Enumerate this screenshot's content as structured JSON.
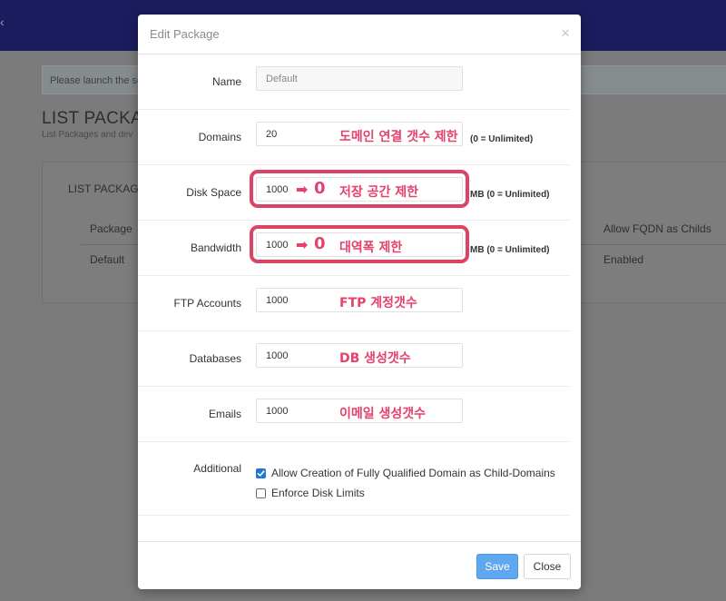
{
  "background": {
    "notice": "Please launch the se",
    "page_title": "LIST PACKAC",
    "page_subtitle": "List Packages and dev",
    "card_title": "LIST PACKAGE",
    "table": {
      "headers": [
        "Package",
        "Allow FQDN as Childs"
      ],
      "row": [
        "Default",
        "Enabled"
      ]
    }
  },
  "modal": {
    "title": "Edit Package",
    "close_glyph": "×",
    "fields": [
      {
        "label": "Name",
        "value": "Default",
        "help": "",
        "annotation": ""
      },
      {
        "label": "Domains",
        "value": "20",
        "help": "(0 = Unlimited)",
        "annotation": "도메인 연결 갯수 제한"
      },
      {
        "label": "Disk Space",
        "value": "1000",
        "help": "MB (0 = Unlimited)",
        "annotation": "저장 공간 제한"
      },
      {
        "label": "Bandwidth",
        "value": "1000",
        "help": "MB (0 = Unlimited)",
        "annotation": "대역폭 제한"
      },
      {
        "label": "FTP Accounts",
        "value": "1000",
        "help": "",
        "annotation": "FTP 계정갯수"
      },
      {
        "label": "Databases",
        "value": "1000",
        "help": "",
        "annotation": "DB 생성갯수"
      },
      {
        "label": "Emails",
        "value": "1000",
        "help": "",
        "annotation": "이메일 생성갯수"
      }
    ],
    "annotation_arrow": "➡",
    "annotation_zero": "0",
    "additional": {
      "label": "Additional",
      "options": [
        {
          "label": "Allow Creation of Fully Qualified Domain as Child-Domains",
          "checked": true
        },
        {
          "label": "Enforce Disk Limits",
          "checked": false
        }
      ]
    },
    "footer": {
      "save_label": "Save",
      "close_label": "Close"
    }
  },
  "colors": {
    "topbar": "#1a1c5e",
    "annotation": "#e4416b",
    "save_button": "#5fa7ef",
    "checkbox_checked": "#1f78d1"
  }
}
